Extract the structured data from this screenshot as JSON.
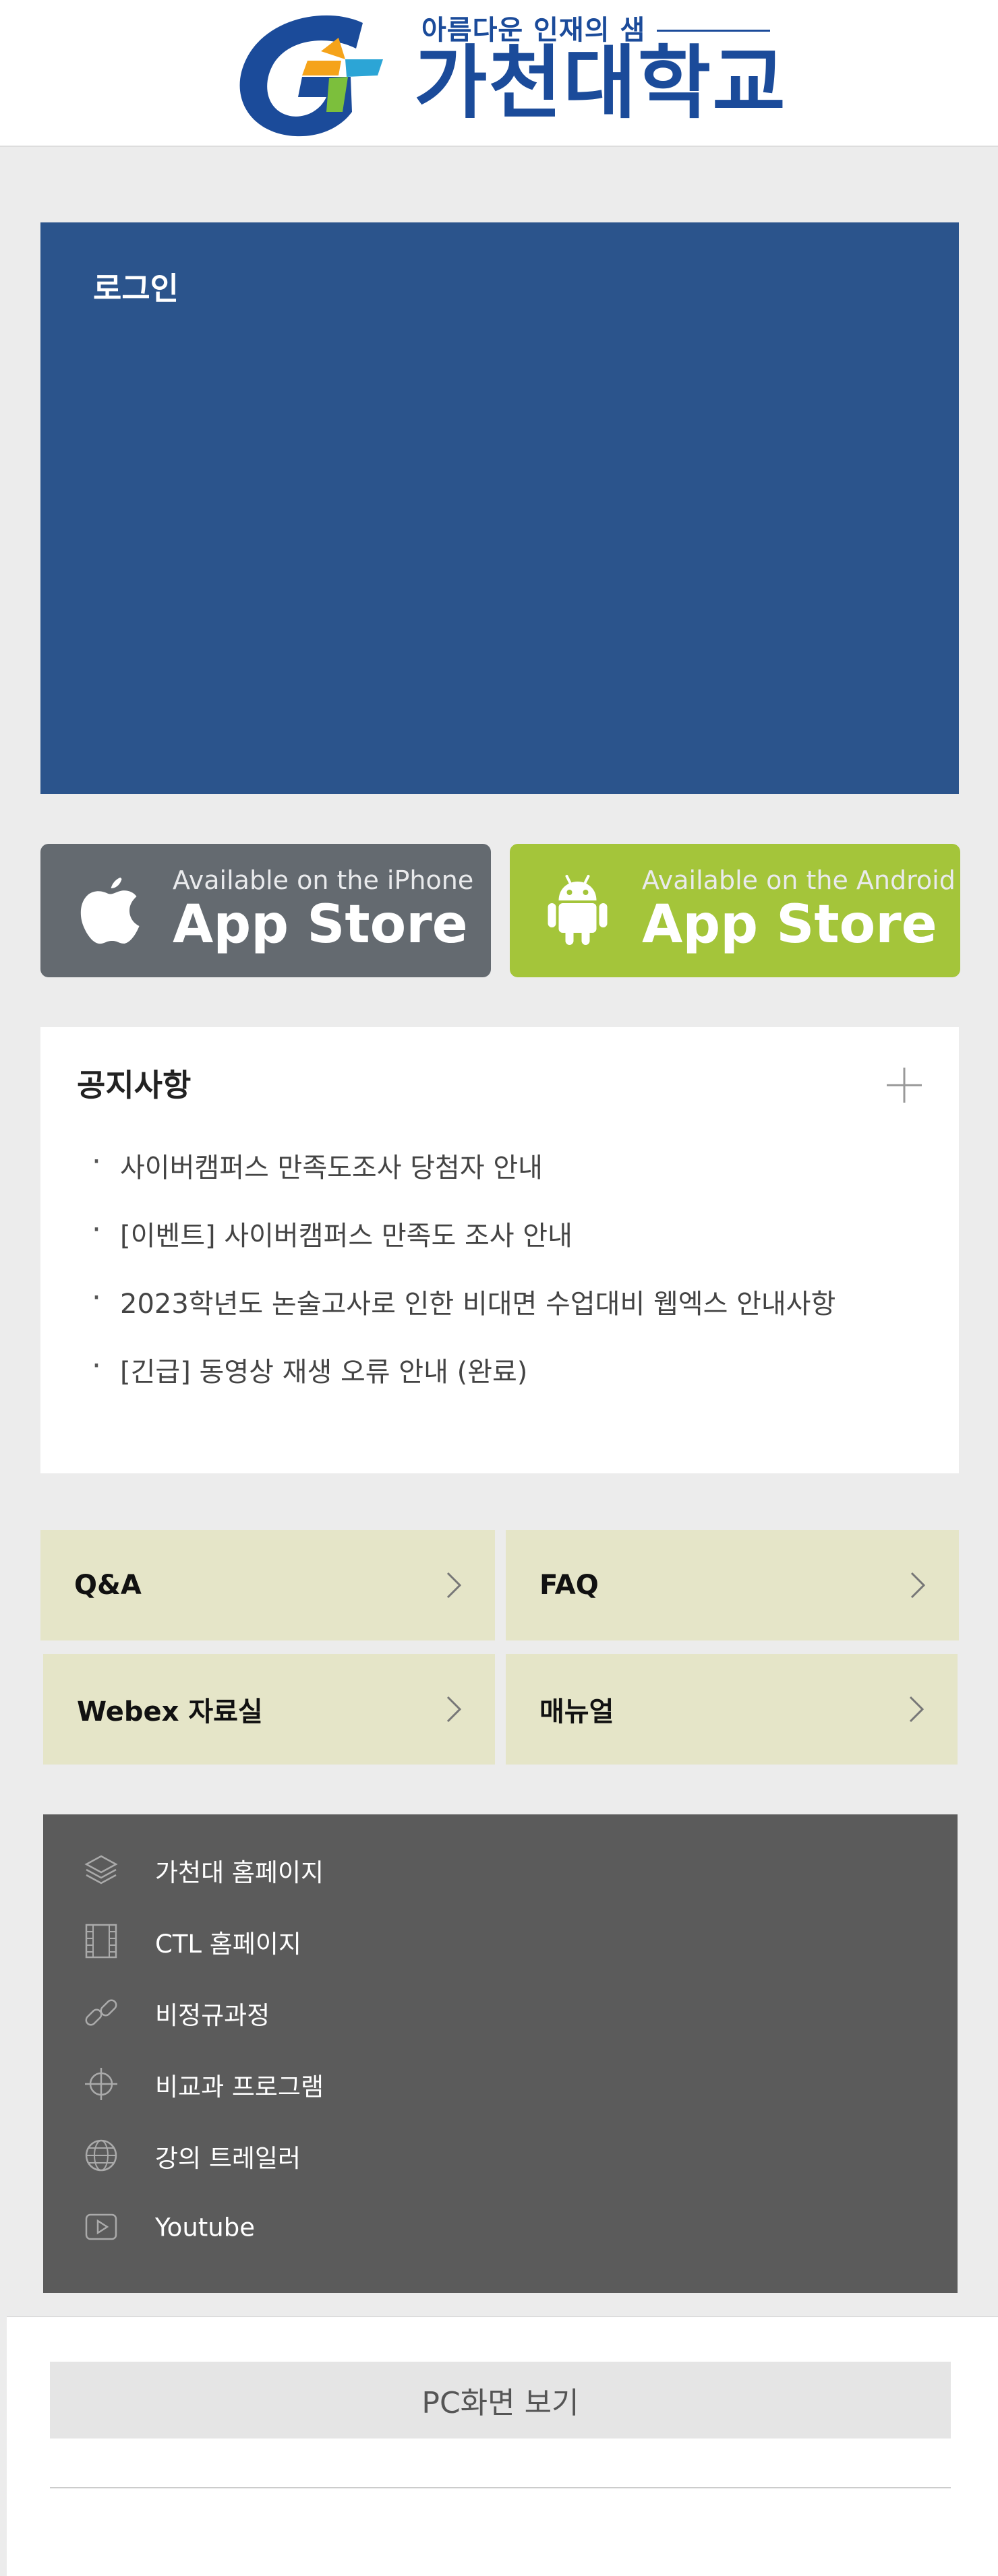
{
  "header": {
    "logo_slogan": "아름다운 인재의 샘",
    "logo_name": "가천대학교"
  },
  "login": {
    "title": "로그인"
  },
  "app_buttons": {
    "ios": {
      "small": "Available on the iPhone",
      "big": "App Store",
      "icon": "apple-icon",
      "color": "#646a70"
    },
    "android": {
      "small": "Available on the Android",
      "big": "App Store",
      "icon": "android-icon",
      "color": "#a4c53a"
    }
  },
  "notice": {
    "title": "공지사항",
    "more_icon": "plus-icon",
    "items": [
      "사이버캠퍼스 만족도조사 당첨자 안내",
      "[이벤트] 사이버캠퍼스 만족도 조사 안내",
      "2023학년도 논술고사로 인한 비대면 수업대비 웹엑스 안내사항",
      "[긴급] 동영상 재생 오류 안내 (완료)"
    ]
  },
  "quick_links": [
    {
      "label": "Q&A"
    },
    {
      "label": "FAQ"
    },
    {
      "label": "Webex 자료실"
    },
    {
      "label": "매뉴얼"
    }
  ],
  "site_links": [
    {
      "label": "가천대 홈페이지",
      "icon": "layers-icon"
    },
    {
      "label": "CTL 홈페이지",
      "icon": "film-icon"
    },
    {
      "label": "비정규과정",
      "icon": "link-icon"
    },
    {
      "label": "비교과 프로그램",
      "icon": "crosshair-icon"
    },
    {
      "label": "강의 트레일러",
      "icon": "globe-icon"
    },
    {
      "label": "Youtube",
      "icon": "play-icon"
    }
  ],
  "footer": {
    "pc_view_label": "PC화면 보기"
  },
  "colors": {
    "brand_blue": "#2b548c",
    "quick_bg": "#e5e5c8",
    "links_bg": "#5b5b5b"
  }
}
